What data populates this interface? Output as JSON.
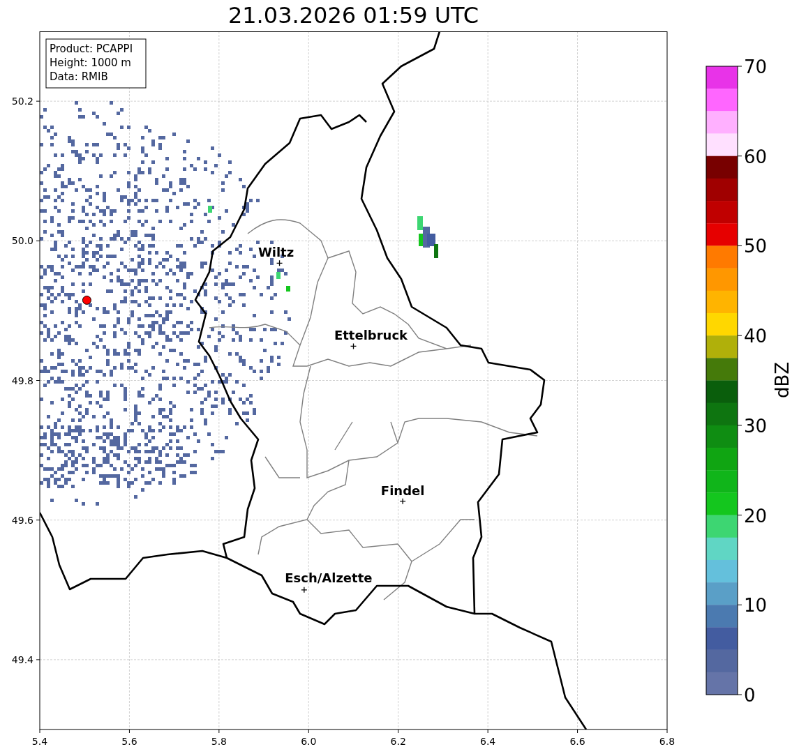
{
  "title": "21.03.2026 01:59 UTC",
  "info_box": [
    "Product: PCAPPI",
    "Height: 1000 m",
    "Data: RMIB"
  ],
  "map": {
    "x_ticks": [
      "5.4",
      "5.6",
      "5.8",
      "6.0",
      "6.2",
      "6.4",
      "6.6",
      "6.8"
    ],
    "y_ticks": [
      "50.2",
      "50.0",
      "49.8",
      "49.6",
      "49.4"
    ],
    "cities": [
      "Wiltz",
      "Ettelbruck",
      "Findel",
      "Esch/Alzette"
    ]
  },
  "colorbar": {
    "label": "dBZ",
    "ticks": [
      "70",
      "60",
      "50",
      "40",
      "30",
      "20",
      "10",
      "0"
    ],
    "bins": [
      {
        "color": "#e833e8"
      },
      {
        "color": "#ff66ff"
      },
      {
        "color": "#ffb0ff"
      },
      {
        "color": "#ffe0ff"
      },
      {
        "color": "#780000"
      },
      {
        "color": "#a00000"
      },
      {
        "color": "#c00000"
      },
      {
        "color": "#e60000"
      },
      {
        "color": "#ff7a00"
      },
      {
        "color": "#ff9700"
      },
      {
        "color": "#ffb400"
      },
      {
        "color": "#ffd700"
      },
      {
        "color": "#b0b00a"
      },
      {
        "color": "#457a0a"
      },
      {
        "color": "#0a5e0c"
      },
      {
        "color": "#0e7510"
      },
      {
        "color": "#0f8d12"
      },
      {
        "color": "#10a512"
      },
      {
        "color": "#10b51a"
      },
      {
        "color": "#14c61e"
      },
      {
        "color": "#3dd672"
      },
      {
        "color": "#60d6c4"
      },
      {
        "color": "#64c0dc"
      },
      {
        "color": "#5a9fc7"
      },
      {
        "color": "#4b7ab0"
      },
      {
        "color": "#435ca0"
      },
      {
        "color": "#5468a0"
      },
      {
        "color": "#6574a8"
      }
    ]
  }
}
